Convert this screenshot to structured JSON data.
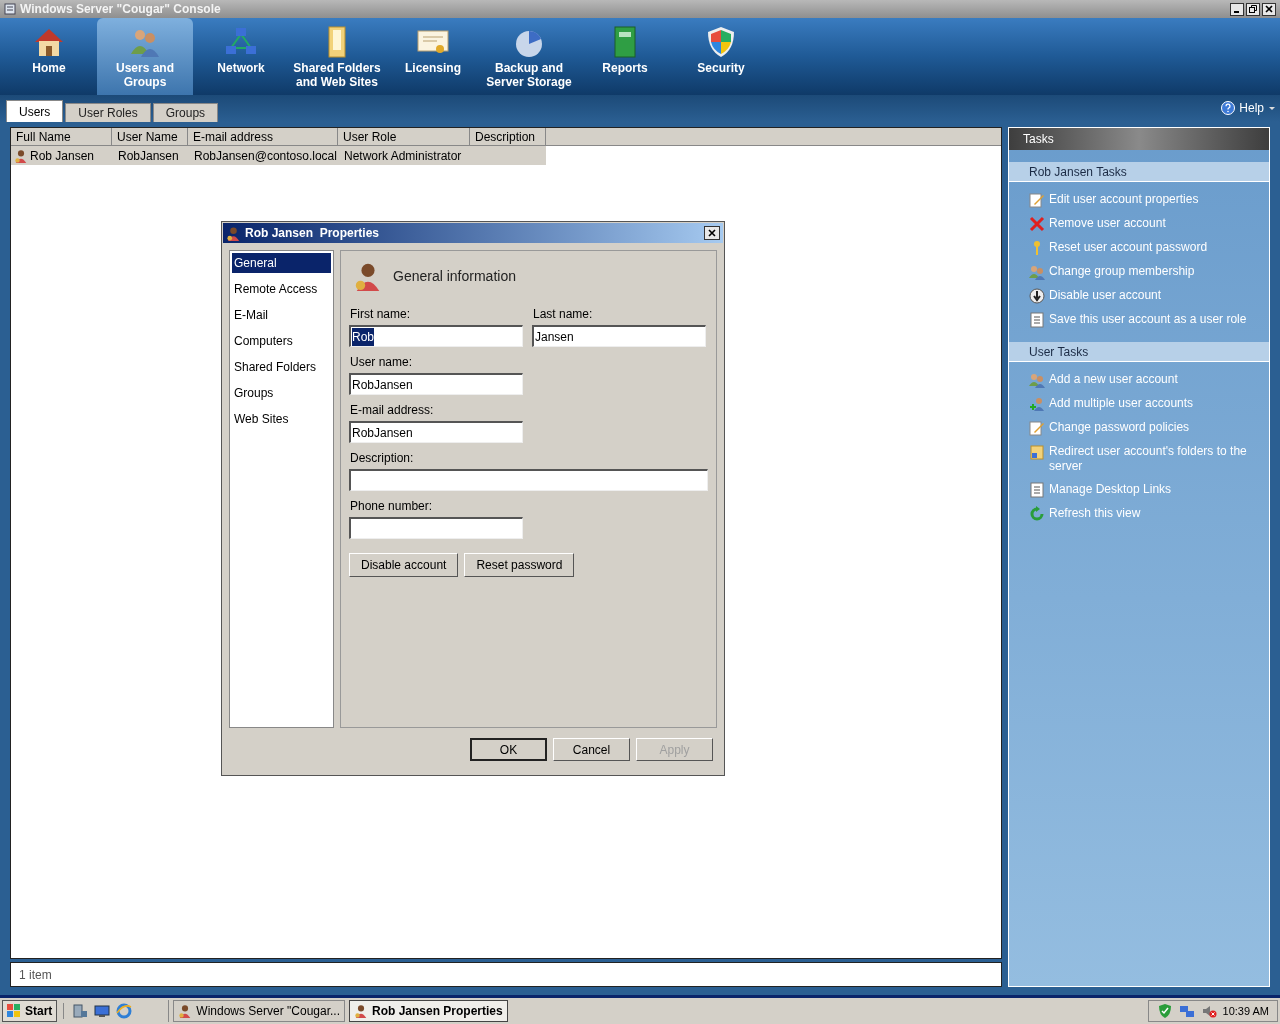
{
  "window": {
    "title": "Windows Server \"Cougar\" Console"
  },
  "nav": [
    {
      "label": "Home",
      "selected": false
    },
    {
      "label": "Users and Groups",
      "selected": true
    },
    {
      "label": "Network",
      "selected": false
    },
    {
      "label": "Shared Folders and Web Sites",
      "selected": false
    },
    {
      "label": "Licensing",
      "selected": false
    },
    {
      "label": "Backup and Server Storage",
      "selected": false
    },
    {
      "label": "Reports",
      "selected": false
    },
    {
      "label": "Security",
      "selected": false
    }
  ],
  "tabs": [
    {
      "label": "Users",
      "selected": true
    },
    {
      "label": "User Roles",
      "selected": false
    },
    {
      "label": "Groups",
      "selected": false
    }
  ],
  "help": {
    "label": "Help"
  },
  "table": {
    "columns": [
      "Full Name",
      "User Name",
      "E-mail address",
      "User Role",
      "Description"
    ],
    "rows": [
      {
        "cells": [
          "Rob Jansen",
          "RobJansen",
          "RobJansen@contoso.local",
          "Network Administrator",
          null
        ],
        "selected": true
      }
    ]
  },
  "status_bar": {
    "text": "1 item"
  },
  "tasks": {
    "title": "Tasks",
    "sections": [
      {
        "title": "Rob Jansen Tasks",
        "items": [
          {
            "label": "Edit user account properties"
          },
          {
            "label": "Remove user account"
          },
          {
            "label": "Reset user account password"
          },
          {
            "label": "Change group membership"
          },
          {
            "label": "Disable user account"
          },
          {
            "label": "Save this user account as a user role"
          }
        ]
      },
      {
        "title": "User Tasks",
        "items": [
          {
            "label": "Add a new user account"
          },
          {
            "label": "Add multiple user accounts"
          },
          {
            "label": "Change password policies"
          },
          {
            "label": "Redirect user account's folders to the server"
          },
          {
            "label": "Manage Desktop Links"
          },
          {
            "label": "Refresh this view"
          }
        ]
      }
    ]
  },
  "dialog": {
    "title": "Rob Jansen  Properties",
    "pages": [
      {
        "label": "General",
        "selected": true
      },
      {
        "label": "Remote Access",
        "selected": false
      },
      {
        "label": "E-Mail",
        "selected": false
      },
      {
        "label": "Computers",
        "selected": false
      },
      {
        "label": "Shared Folders",
        "selected": false
      },
      {
        "label": "Groups",
        "selected": false
      },
      {
        "label": "Web Sites",
        "selected": false
      }
    ],
    "heading": "General information",
    "field_rows": [
      [
        {
          "label": "First name:",
          "value": "Rob",
          "kind": "short",
          "text_selected": true
        },
        {
          "label": "Last name:",
          "value": "Jansen",
          "kind": "short",
          "text_selected": false
        }
      ],
      [
        {
          "label": "User name:",
          "value": "RobJansen",
          "kind": "short",
          "text_selected": false
        }
      ],
      [
        {
          "label": "E-mail address:",
          "value": "RobJansen",
          "kind": "short",
          "text_selected": false
        }
      ],
      [
        {
          "label": "Description:",
          "kind": "wide"
        }
      ],
      [
        {
          "label": "Phone number:",
          "kind": "short"
        }
      ]
    ],
    "actions": [
      "Disable account",
      "Reset password"
    ],
    "buttons": [
      {
        "label": "OK",
        "disabled": false,
        "default": true
      },
      {
        "label": "Cancel",
        "disabled": false,
        "default": false
      },
      {
        "label": "Apply",
        "disabled": true,
        "default": false
      }
    ]
  },
  "taskbar": {
    "start": "Start",
    "tasks": [
      {
        "label": "Windows Server \"Cougar...",
        "selected": false
      },
      {
        "label": "Rob Jansen  Properties",
        "selected": true
      }
    ],
    "clock": "10:39 AM"
  }
}
